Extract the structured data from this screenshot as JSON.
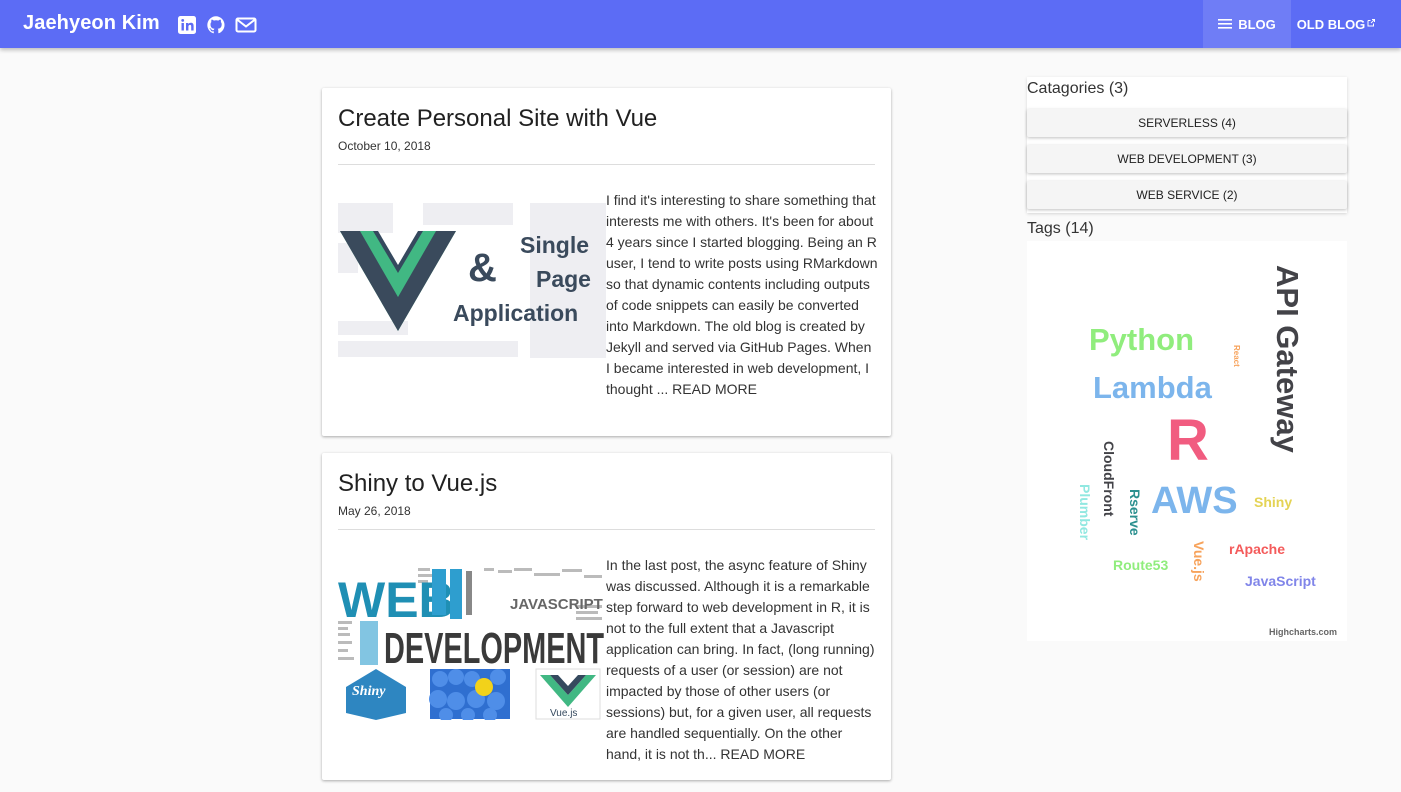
{
  "header": {
    "brand": "Jaehyeon Kim",
    "social_icons": [
      "linkedin-icon",
      "github-icon",
      "mail-icon"
    ],
    "nav": {
      "blog_label": "BLOG",
      "old_blog_label": "OLD BLOG"
    },
    "colors": {
      "bar": "#5c6cf5"
    }
  },
  "posts": [
    {
      "title": "Create Personal Site with Vue",
      "date": "October 10, 2018",
      "image_text": {
        "a": "&",
        "b": "Single",
        "c": "Page",
        "d": "Application"
      },
      "excerpt": "I find it's interesting to share something that interests me with others. It's been for about 4 years since I started blogging. Being an R user, I tend to write posts using RMarkdown so that dynamic contents including outputs of code snippets can easily be converted into Markdown. The old blog is created by Jekyll and served via GitHub Pages. When I became interested in web development, I thought ...",
      "read_more": "READ MORE"
    },
    {
      "title": "Shiny to Vue.js",
      "date": "May 26, 2018",
      "image_text": {
        "a": "WEB",
        "b": "DEVELOPMENT",
        "c": "JAVASCRIPT",
        "d": "Shiny",
        "e": "Vue.js"
      },
      "excerpt": "In the last post, the async feature of Shiny was discussed. Although it is a remarkable step forward to web development in R, it is not to the full extent that a Javascript application can bring. In fact, (long running) requests of a user (or session) are not impacted by those of other users (or sessions) but, for a given user, all requests are handled sequentially. On the other hand, it is not th...",
      "read_more": "READ MORE"
    }
  ],
  "sidebar": {
    "categories_heading": "Catagories (3)",
    "categories": [
      "SERVERLESS (4)",
      "WEB DEVELOPMENT (3)",
      "WEB SERVICE (2)"
    ],
    "tags_heading": "Tags (14)",
    "tags": [
      {
        "label": "API Gateway",
        "color": "#434348"
      },
      {
        "label": "Python",
        "color": "#90ed7d"
      },
      {
        "label": "React",
        "color": "#f7a35c"
      },
      {
        "label": "Lambda",
        "color": "#7cb5ec"
      },
      {
        "label": "R",
        "color": "#f15c80"
      },
      {
        "label": "CloudFront",
        "color": "#434348"
      },
      {
        "label": "Rserve",
        "color": "#2b908f"
      },
      {
        "label": "AWS",
        "color": "#7cb5ec"
      },
      {
        "label": "Shiny",
        "color": "#e4d354"
      },
      {
        "label": "Plumber",
        "color": "#91e8e1"
      },
      {
        "label": "Vue.js",
        "color": "#f7a35c"
      },
      {
        "label": "rApache",
        "color": "#f45b5b"
      },
      {
        "label": "Route53",
        "color": "#90ed7d"
      },
      {
        "label": "JavaScript",
        "color": "#8085e9"
      }
    ],
    "credits": "Highcharts.com"
  }
}
